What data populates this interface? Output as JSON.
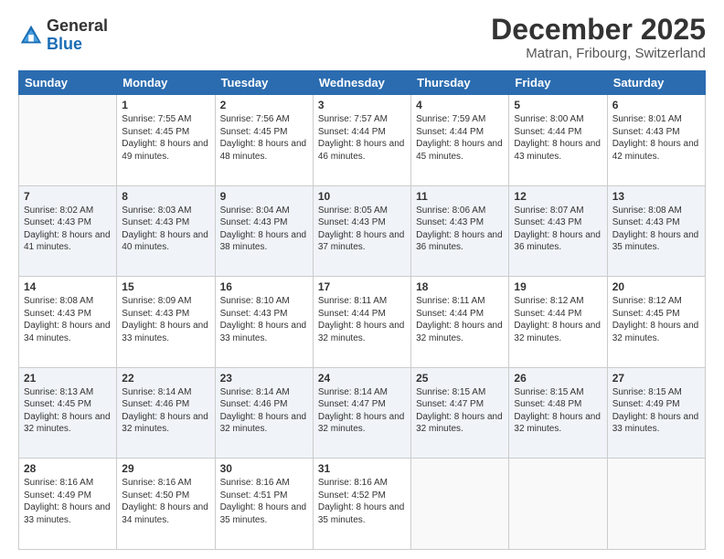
{
  "logo": {
    "general": "General",
    "blue": "Blue"
  },
  "header": {
    "month": "December 2025",
    "location": "Matran, Fribourg, Switzerland"
  },
  "weekdays": [
    "Sunday",
    "Monday",
    "Tuesday",
    "Wednesday",
    "Thursday",
    "Friday",
    "Saturday"
  ],
  "weeks": [
    [
      {
        "day": "",
        "sunrise": "",
        "sunset": "",
        "daylight": ""
      },
      {
        "day": "1",
        "sunrise": "Sunrise: 7:55 AM",
        "sunset": "Sunset: 4:45 PM",
        "daylight": "Daylight: 8 hours and 49 minutes."
      },
      {
        "day": "2",
        "sunrise": "Sunrise: 7:56 AM",
        "sunset": "Sunset: 4:45 PM",
        "daylight": "Daylight: 8 hours and 48 minutes."
      },
      {
        "day": "3",
        "sunrise": "Sunrise: 7:57 AM",
        "sunset": "Sunset: 4:44 PM",
        "daylight": "Daylight: 8 hours and 46 minutes."
      },
      {
        "day": "4",
        "sunrise": "Sunrise: 7:59 AM",
        "sunset": "Sunset: 4:44 PM",
        "daylight": "Daylight: 8 hours and 45 minutes."
      },
      {
        "day": "5",
        "sunrise": "Sunrise: 8:00 AM",
        "sunset": "Sunset: 4:44 PM",
        "daylight": "Daylight: 8 hours and 43 minutes."
      },
      {
        "day": "6",
        "sunrise": "Sunrise: 8:01 AM",
        "sunset": "Sunset: 4:43 PM",
        "daylight": "Daylight: 8 hours and 42 minutes."
      }
    ],
    [
      {
        "day": "7",
        "sunrise": "Sunrise: 8:02 AM",
        "sunset": "Sunset: 4:43 PM",
        "daylight": "Daylight: 8 hours and 41 minutes."
      },
      {
        "day": "8",
        "sunrise": "Sunrise: 8:03 AM",
        "sunset": "Sunset: 4:43 PM",
        "daylight": "Daylight: 8 hours and 40 minutes."
      },
      {
        "day": "9",
        "sunrise": "Sunrise: 8:04 AM",
        "sunset": "Sunset: 4:43 PM",
        "daylight": "Daylight: 8 hours and 38 minutes."
      },
      {
        "day": "10",
        "sunrise": "Sunrise: 8:05 AM",
        "sunset": "Sunset: 4:43 PM",
        "daylight": "Daylight: 8 hours and 37 minutes."
      },
      {
        "day": "11",
        "sunrise": "Sunrise: 8:06 AM",
        "sunset": "Sunset: 4:43 PM",
        "daylight": "Daylight: 8 hours and 36 minutes."
      },
      {
        "day": "12",
        "sunrise": "Sunrise: 8:07 AM",
        "sunset": "Sunset: 4:43 PM",
        "daylight": "Daylight: 8 hours and 36 minutes."
      },
      {
        "day": "13",
        "sunrise": "Sunrise: 8:08 AM",
        "sunset": "Sunset: 4:43 PM",
        "daylight": "Daylight: 8 hours and 35 minutes."
      }
    ],
    [
      {
        "day": "14",
        "sunrise": "Sunrise: 8:08 AM",
        "sunset": "Sunset: 4:43 PM",
        "daylight": "Daylight: 8 hours and 34 minutes."
      },
      {
        "day": "15",
        "sunrise": "Sunrise: 8:09 AM",
        "sunset": "Sunset: 4:43 PM",
        "daylight": "Daylight: 8 hours and 33 minutes."
      },
      {
        "day": "16",
        "sunrise": "Sunrise: 8:10 AM",
        "sunset": "Sunset: 4:43 PM",
        "daylight": "Daylight: 8 hours and 33 minutes."
      },
      {
        "day": "17",
        "sunrise": "Sunrise: 8:11 AM",
        "sunset": "Sunset: 4:44 PM",
        "daylight": "Daylight: 8 hours and 32 minutes."
      },
      {
        "day": "18",
        "sunrise": "Sunrise: 8:11 AM",
        "sunset": "Sunset: 4:44 PM",
        "daylight": "Daylight: 8 hours and 32 minutes."
      },
      {
        "day": "19",
        "sunrise": "Sunrise: 8:12 AM",
        "sunset": "Sunset: 4:44 PM",
        "daylight": "Daylight: 8 hours and 32 minutes."
      },
      {
        "day": "20",
        "sunrise": "Sunrise: 8:12 AM",
        "sunset": "Sunset: 4:45 PM",
        "daylight": "Daylight: 8 hours and 32 minutes."
      }
    ],
    [
      {
        "day": "21",
        "sunrise": "Sunrise: 8:13 AM",
        "sunset": "Sunset: 4:45 PM",
        "daylight": "Daylight: 8 hours and 32 minutes."
      },
      {
        "day": "22",
        "sunrise": "Sunrise: 8:14 AM",
        "sunset": "Sunset: 4:46 PM",
        "daylight": "Daylight: 8 hours and 32 minutes."
      },
      {
        "day": "23",
        "sunrise": "Sunrise: 8:14 AM",
        "sunset": "Sunset: 4:46 PM",
        "daylight": "Daylight: 8 hours and 32 minutes."
      },
      {
        "day": "24",
        "sunrise": "Sunrise: 8:14 AM",
        "sunset": "Sunset: 4:47 PM",
        "daylight": "Daylight: 8 hours and 32 minutes."
      },
      {
        "day": "25",
        "sunrise": "Sunrise: 8:15 AM",
        "sunset": "Sunset: 4:47 PM",
        "daylight": "Daylight: 8 hours and 32 minutes."
      },
      {
        "day": "26",
        "sunrise": "Sunrise: 8:15 AM",
        "sunset": "Sunset: 4:48 PM",
        "daylight": "Daylight: 8 hours and 32 minutes."
      },
      {
        "day": "27",
        "sunrise": "Sunrise: 8:15 AM",
        "sunset": "Sunset: 4:49 PM",
        "daylight": "Daylight: 8 hours and 33 minutes."
      }
    ],
    [
      {
        "day": "28",
        "sunrise": "Sunrise: 8:16 AM",
        "sunset": "Sunset: 4:49 PM",
        "daylight": "Daylight: 8 hours and 33 minutes."
      },
      {
        "day": "29",
        "sunrise": "Sunrise: 8:16 AM",
        "sunset": "Sunset: 4:50 PM",
        "daylight": "Daylight: 8 hours and 34 minutes."
      },
      {
        "day": "30",
        "sunrise": "Sunrise: 8:16 AM",
        "sunset": "Sunset: 4:51 PM",
        "daylight": "Daylight: 8 hours and 35 minutes."
      },
      {
        "day": "31",
        "sunrise": "Sunrise: 8:16 AM",
        "sunset": "Sunset: 4:52 PM",
        "daylight": "Daylight: 8 hours and 35 minutes."
      },
      {
        "day": "",
        "sunrise": "",
        "sunset": "",
        "daylight": ""
      },
      {
        "day": "",
        "sunrise": "",
        "sunset": "",
        "daylight": ""
      },
      {
        "day": "",
        "sunrise": "",
        "sunset": "",
        "daylight": ""
      }
    ]
  ]
}
